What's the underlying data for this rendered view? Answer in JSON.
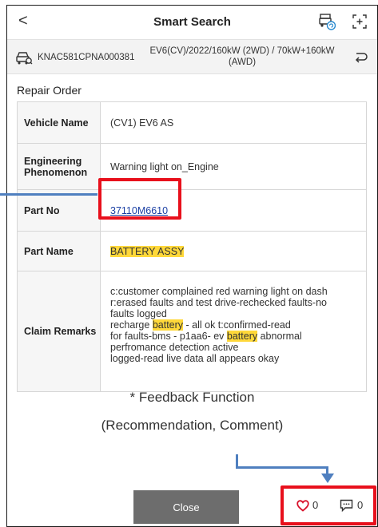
{
  "header": {
    "back_glyph": "<",
    "title": "Smart Search"
  },
  "vehicle_bar": {
    "vin": "KNAC581CPNA000381",
    "spec_line1": "EV6(CV)/2022/160kW (2WD) / 70kW+160kW",
    "spec_line2": "(AWD)"
  },
  "repair_order": {
    "section_title": "Repair Order",
    "vehicle_name_label": "Vehicle Name",
    "vehicle_name_value": "(CV1) EV6 AS",
    "engineering_label_1": "Engineering",
    "engineering_label_2": "Phenomenon",
    "engineering_value": "Warning light on_Engine",
    "part_no_label": "Part No",
    "part_no_value": "37110M6610",
    "part_name_label": "Part Name",
    "part_name_value": "BATTERY ASSY",
    "claim_remarks_label": "Claim Remarks",
    "remarks": {
      "line1": "c:customer complained red warning light on dash",
      "line2": "r:erased faults and test drive-rechecked faults-no",
      "line3": "faults logged",
      "line4_pre": "recharge ",
      "line4_hl": "battery",
      "line4_post": " - all ok t:confirmed-read",
      "line5_pre": "for faults-bms - p1aa6- ev ",
      "line5_hl": "battery",
      "line5_post": " abnormal",
      "line6": "perfromance detection active",
      "line7": "logged-read live data all appears okay"
    }
  },
  "annotation": {
    "line1": "* Feedback Function",
    "line2": "(Recommendation, Comment)"
  },
  "footer": {
    "close_label": "Close",
    "like_count": "0",
    "comment_count": "0"
  },
  "colors": {
    "highlight": "#ffd83a",
    "callout_red": "#e8101c",
    "callout_blue": "#4f7fbf",
    "link": "#1a3fa3",
    "close_button": "#6d6d6d"
  }
}
